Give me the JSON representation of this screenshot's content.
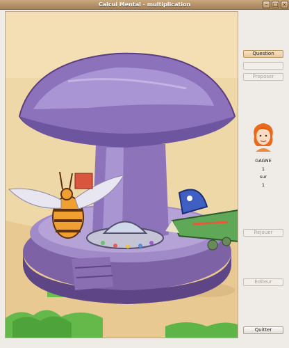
{
  "window": {
    "title": "Calcul Mental - multiplication"
  },
  "sidebar": {
    "question_label": "Question",
    "answer_input_value": "",
    "proposer_label": "Proposer",
    "result_status": "GAGNE",
    "score_value": "1",
    "score_separator": "sur",
    "score_total": "1",
    "rejouer_label": "Rejouer",
    "editeur_label": "Editeur",
    "quitter_label": "Quitter"
  }
}
